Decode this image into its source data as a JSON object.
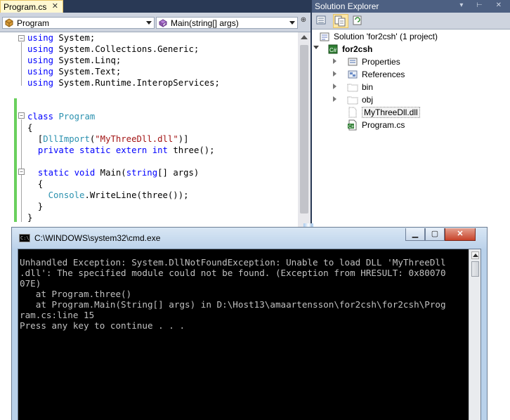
{
  "editor": {
    "tab": {
      "label": "Program.cs",
      "close": "✕"
    },
    "class_combo": {
      "value": "Program"
    },
    "member_combo": {
      "value": "Main(string[] args)"
    },
    "code_lines": [
      [
        {
          "t": "using",
          "c": "kw"
        },
        {
          "t": " System;",
          "c": ""
        }
      ],
      [
        {
          "t": "using",
          "c": "kw"
        },
        {
          "t": " System.Collections.Generic;",
          "c": ""
        }
      ],
      [
        {
          "t": "using",
          "c": "kw"
        },
        {
          "t": " System.Linq;",
          "c": ""
        }
      ],
      [
        {
          "t": "using",
          "c": "kw"
        },
        {
          "t": " System.Text;",
          "c": ""
        }
      ],
      [
        {
          "t": "using",
          "c": "kw"
        },
        {
          "t": " System.Runtime.InteropServices;",
          "c": ""
        }
      ],
      [],
      [],
      [
        {
          "t": "class",
          "c": "kw"
        },
        {
          "t": " ",
          "c": ""
        },
        {
          "t": "Program",
          "c": "ty"
        }
      ],
      [
        {
          "t": "{",
          "c": ""
        }
      ],
      [
        {
          "t": "  [",
          "c": ""
        },
        {
          "t": "DllImport",
          "c": "ty"
        },
        {
          "t": "(",
          "c": ""
        },
        {
          "t": "\"MyThreeDll.dll\"",
          "c": "st"
        },
        {
          "t": ")]",
          "c": ""
        }
      ],
      [
        {
          "t": "  ",
          "c": ""
        },
        {
          "t": "private",
          "c": "kw"
        },
        {
          "t": " ",
          "c": ""
        },
        {
          "t": "static",
          "c": "kw"
        },
        {
          "t": " ",
          "c": ""
        },
        {
          "t": "extern",
          "c": "kw"
        },
        {
          "t": " ",
          "c": ""
        },
        {
          "t": "int",
          "c": "kw"
        },
        {
          "t": " three();",
          "c": ""
        }
      ],
      [],
      [
        {
          "t": "  ",
          "c": ""
        },
        {
          "t": "static",
          "c": "kw"
        },
        {
          "t": " ",
          "c": ""
        },
        {
          "t": "void",
          "c": "kw"
        },
        {
          "t": " Main(",
          "c": ""
        },
        {
          "t": "string",
          "c": "kw"
        },
        {
          "t": "[] args)",
          "c": ""
        }
      ],
      [
        {
          "t": "  {",
          "c": ""
        }
      ],
      [
        {
          "t": "    ",
          "c": ""
        },
        {
          "t": "Console",
          "c": "ty"
        },
        {
          "t": ".WriteLine(three());",
          "c": ""
        }
      ],
      [
        {
          "t": "  }",
          "c": ""
        }
      ],
      [
        {
          "t": "}",
          "c": ""
        }
      ]
    ]
  },
  "solution_explorer": {
    "title": "Solution Explorer",
    "title_buttons": "▾ ⊢ ✕",
    "items": [
      {
        "label": "Solution 'for2csh' (1 project)",
        "icon": "solution-icon",
        "bold": false
      },
      {
        "label": "for2csh",
        "icon": "csharp-project-icon",
        "bold": true
      },
      {
        "label": "Properties",
        "icon": "properties-icon",
        "bold": false
      },
      {
        "label": "References",
        "icon": "references-icon",
        "bold": false
      },
      {
        "label": "bin",
        "icon": "folder-icon",
        "bold": false
      },
      {
        "label": "obj",
        "icon": "folder-icon",
        "bold": false
      },
      {
        "label": "MyThreeDll.dll",
        "icon": "file-icon",
        "bold": false
      },
      {
        "label": "Program.cs",
        "icon": "csharp-file-icon",
        "bold": false
      }
    ]
  },
  "console": {
    "title": "C:\\WINDOWS\\system32\\cmd.exe",
    "icon_text": "C:\\",
    "buttons": {
      "minimize": "▁",
      "maximize": "▢",
      "close": "✕"
    },
    "output": "Unhandled Exception: System.DllNotFoundException: Unable to load DLL 'MyThreeDll\n.dll': The specified module could not be found. (Exception from HRESULT: 0x80070\n07E)\n   at Program.three()\n   at Program.Main(String[] args) in D:\\Host13\\amaartensson\\for2csh\\for2csh\\Prog\nram.cs:line 15\nPress any key to continue . . ."
  },
  "colors": {
    "chrome": "#293955",
    "keyword": "#0000ff",
    "type": "#2b91af",
    "string": "#a31515",
    "change_bar": "#6ad05d",
    "console_bg": "#000000",
    "console_fg": "#c0c0c0"
  }
}
